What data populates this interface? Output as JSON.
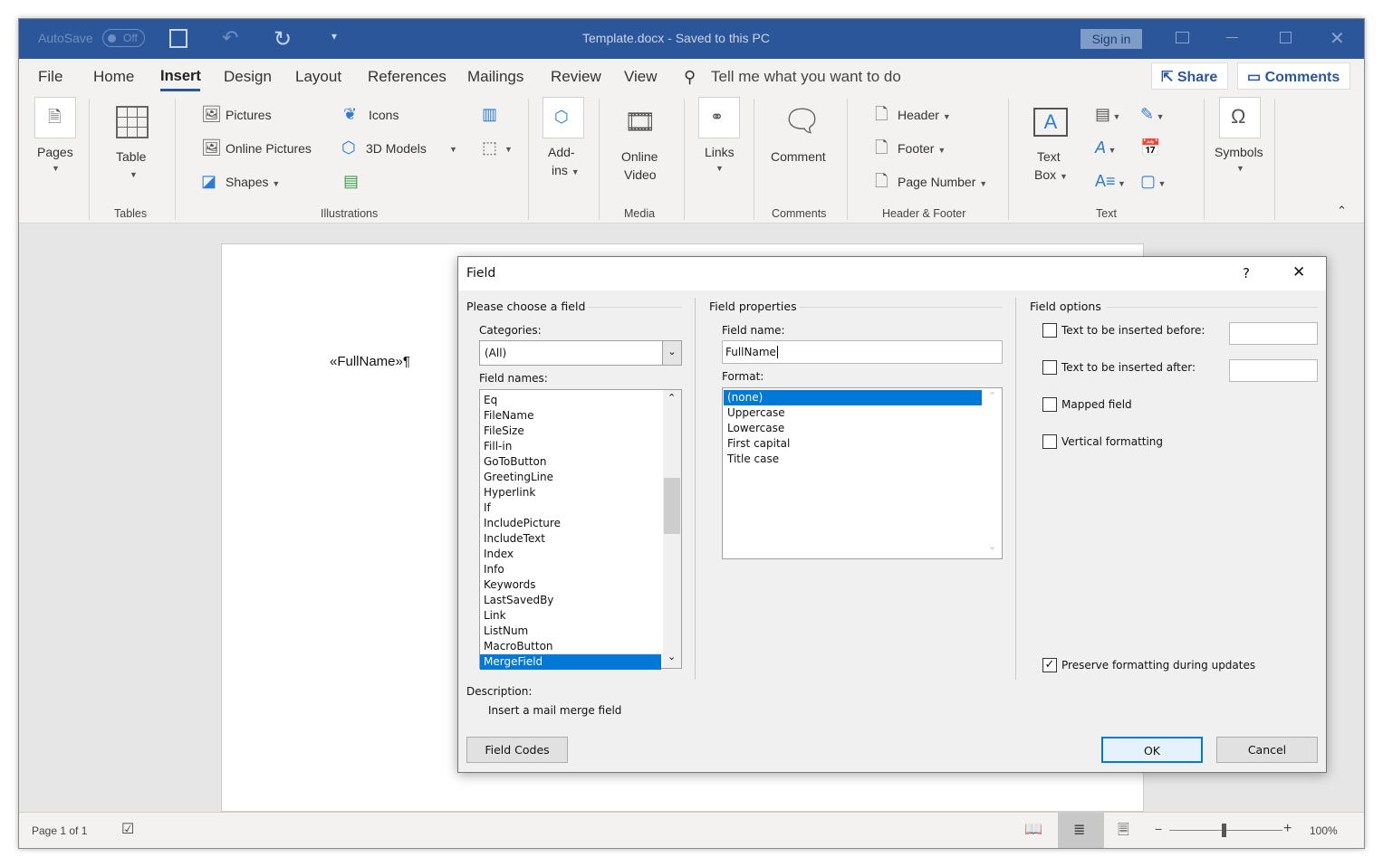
{
  "titlebar": {
    "autosave": "AutoSave",
    "autosave_state": "Off",
    "doc_title": "Template.docx  -  Saved to this PC",
    "sign_in": "Sign in",
    "more": "▾"
  },
  "tabs": [
    "File",
    "Home",
    "Insert",
    "Design",
    "Layout",
    "References",
    "Mailings",
    "Review",
    "View"
  ],
  "active_tab": "Insert",
  "tell_me": "Tell me what you want to do",
  "share": "Share",
  "comments": "Comments",
  "ribbon": {
    "pages": "Pages",
    "table": "Table",
    "tables_group": "Tables",
    "pictures": "Pictures",
    "online_pictures": "Online Pictures",
    "shapes": "Shapes",
    "icons": "Icons",
    "models_3d": "3D Models",
    "illustrations_group": "Illustrations",
    "addins_1": "Add-",
    "addins_2": "ins",
    "online_video_1": "Online",
    "online_video_2": "Video",
    "media_group": "Media",
    "links": "Links",
    "comment": "Comment",
    "comments_group": "Comments",
    "header": "Header",
    "footer": "Footer",
    "page_number": "Page Number",
    "hf_group": "Header & Footer",
    "textbox_1": "Text",
    "textbox_2": "Box",
    "text_group": "Text",
    "symbols": "Symbols"
  },
  "document": {
    "content": "«FullName»¶"
  },
  "statusbar": {
    "page": "Page 1 of 1",
    "zoom": "100%",
    "zoom_level": 100
  },
  "dialog": {
    "title": "Field",
    "help": "?",
    "choose_legend": "Please choose a field",
    "categories_label": "Categories:",
    "categories_value": "(All)",
    "field_names_label": "Field names:",
    "field_names": [
      "Eq",
      "FileName",
      "FileSize",
      "Fill-in",
      "GoToButton",
      "GreetingLine",
      "Hyperlink",
      "If",
      "IncludePicture",
      "IncludeText",
      "Index",
      "Info",
      "Keywords",
      "LastSavedBy",
      "Link",
      "ListNum",
      "MacroButton",
      "MergeField"
    ],
    "selected_field": "MergeField",
    "properties_legend": "Field properties",
    "field_name_label": "Field name:",
    "field_name_value": "FullName",
    "format_label": "Format:",
    "formats": [
      "(none)",
      "Uppercase",
      "Lowercase",
      "First capital",
      "Title case"
    ],
    "selected_format": "(none)",
    "options_legend": "Field options",
    "opt_before": "Text to be inserted before:",
    "opt_after": "Text to be inserted after:",
    "opt_mapped": "Mapped field",
    "opt_vertical": "Vertical formatting",
    "opt_preserve": "Preserve formatting during updates",
    "opt_before_checked": false,
    "opt_after_checked": false,
    "opt_mapped_checked": false,
    "opt_vertical_checked": false,
    "opt_preserve_checked": true,
    "description_label": "Description:",
    "description": "Insert a mail merge field",
    "field_codes": "Field Codes",
    "ok": "OK",
    "cancel": "Cancel"
  },
  "colors": {
    "titlebar": "#2b579a",
    "accent": "#0078d7",
    "tab_underline": "#2b579a"
  }
}
